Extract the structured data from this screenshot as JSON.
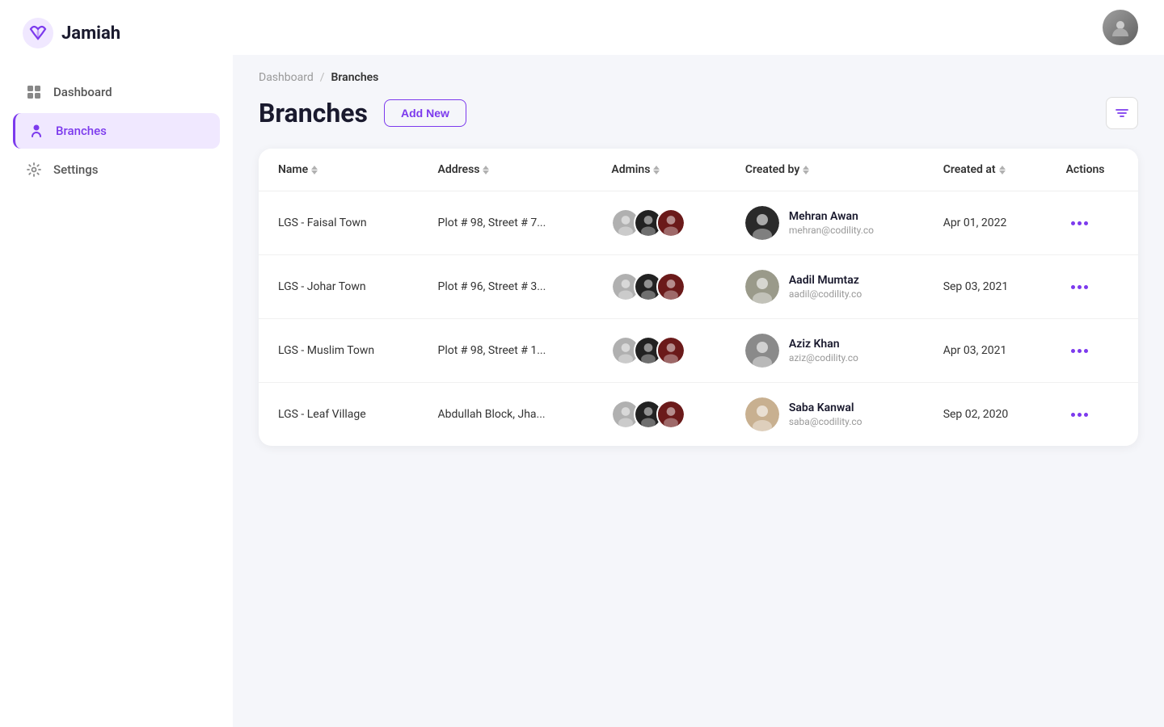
{
  "app": {
    "name": "Jamiah"
  },
  "sidebar": {
    "items": [
      {
        "id": "dashboard",
        "label": "Dashboard",
        "active": false
      },
      {
        "id": "branches",
        "label": "Branches",
        "active": true
      },
      {
        "id": "settings",
        "label": "Settings",
        "active": false
      }
    ]
  },
  "breadcrumb": {
    "parent": "Dashboard",
    "separator": "/",
    "current": "Branches"
  },
  "page": {
    "title": "Branches",
    "add_button": "Add New"
  },
  "table": {
    "columns": [
      {
        "key": "name",
        "label": "Name"
      },
      {
        "key": "address",
        "label": "Address"
      },
      {
        "key": "admins",
        "label": "Admins"
      },
      {
        "key": "created_by",
        "label": "Created by"
      },
      {
        "key": "created_at",
        "label": "Created at"
      },
      {
        "key": "actions",
        "label": "Actions"
      }
    ],
    "rows": [
      {
        "id": 1,
        "name": "LGS - Faisal Town",
        "address": "Plot # 98, Street # 7...",
        "admins": [
          "A1",
          "A2",
          "A3"
        ],
        "creator_name": "Mehran Awan",
        "creator_email": "mehran@codility.co",
        "created_at": "Apr 01, 2022"
      },
      {
        "id": 2,
        "name": "LGS - Johar Town",
        "address": "Plot # 96, Street # 3...",
        "admins": [
          "A1",
          "A2",
          "A3"
        ],
        "creator_name": "Aadil Mumtaz",
        "creator_email": "aadil@codility.co",
        "created_at": "Sep 03, 2021"
      },
      {
        "id": 3,
        "name": "LGS - Muslim Town",
        "address": "Plot # 98, Street # 1...",
        "admins": [
          "A1",
          "A2",
          "A3"
        ],
        "creator_name": "Aziz Khan",
        "creator_email": "aziz@codility.co",
        "created_at": "Apr 03, 2021"
      },
      {
        "id": 4,
        "name": "LGS -  Leaf Village",
        "address": "Abdullah Block, Jha...",
        "admins": [
          "A1",
          "A2",
          "A3"
        ],
        "creator_name": "Saba Kanwal",
        "creator_email": "saba@codility.co",
        "created_at": "Sep 02, 2020"
      }
    ]
  }
}
